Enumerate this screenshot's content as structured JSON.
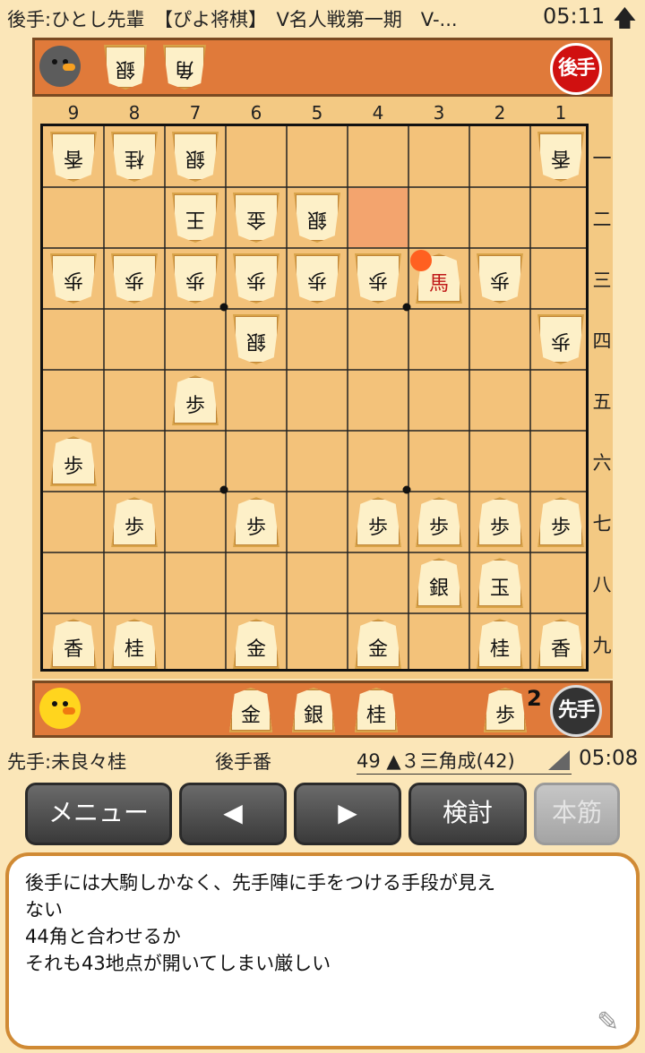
{
  "status_bar": {
    "title": "後手:ひとし先輩　【ぴよ将棋】　V名人戦第一期　V-...",
    "time": "05:11",
    "arrow": "🡅"
  },
  "gote": {
    "badge": "後手",
    "hand": [
      "銀",
      "角"
    ],
    "avatar_color": "#5c5c5c"
  },
  "sente": {
    "badge": "先手",
    "hand": [
      "金",
      "銀",
      "桂",
      "歩"
    ],
    "pawn_count": "2",
    "avatar_color": "#ffd51e"
  },
  "board": {
    "col_labels": [
      "9",
      "8",
      "7",
      "6",
      "5",
      "4",
      "3",
      "2",
      "1"
    ],
    "row_labels": [
      "一",
      "二",
      "三",
      "四",
      "五",
      "六",
      "七",
      "八",
      "九"
    ],
    "highlight_square": "4二",
    "pieces_gote": [
      {
        "sq": "9一",
        "p": "香"
      },
      {
        "sq": "8一",
        "p": "桂"
      },
      {
        "sq": "7一",
        "p": "銀"
      },
      {
        "sq": "1一",
        "p": "香"
      },
      {
        "sq": "7二",
        "p": "王"
      },
      {
        "sq": "6二",
        "p": "金"
      },
      {
        "sq": "5二",
        "p": "銀"
      },
      {
        "sq": "9三",
        "p": "歩"
      },
      {
        "sq": "8三",
        "p": "歩"
      },
      {
        "sq": "7三",
        "p": "歩"
      },
      {
        "sq": "6三",
        "p": "歩"
      },
      {
        "sq": "5三",
        "p": "歩"
      },
      {
        "sq": "4三",
        "p": "歩"
      },
      {
        "sq": "2三",
        "p": "歩"
      },
      {
        "sq": "6四",
        "p": "銀"
      },
      {
        "sq": "1四",
        "p": "歩"
      }
    ],
    "pieces_sente": [
      {
        "sq": "3三",
        "p": "馬",
        "promoted": true
      },
      {
        "sq": "7五",
        "p": "歩"
      },
      {
        "sq": "9六",
        "p": "歩"
      },
      {
        "sq": "8七",
        "p": "歩"
      },
      {
        "sq": "6七",
        "p": "歩"
      },
      {
        "sq": "4七",
        "p": "歩"
      },
      {
        "sq": "3七",
        "p": "歩"
      },
      {
        "sq": "2七",
        "p": "歩"
      },
      {
        "sq": "1七",
        "p": "歩"
      },
      {
        "sq": "3八",
        "p": "銀"
      },
      {
        "sq": "2八",
        "p": "玉"
      },
      {
        "sq": "9九",
        "p": "香"
      },
      {
        "sq": "8九",
        "p": "桂"
      },
      {
        "sq": "6九",
        "p": "金"
      },
      {
        "sq": "4九",
        "p": "金"
      },
      {
        "sq": "2九",
        "p": "桂"
      },
      {
        "sq": "1九",
        "p": "香"
      }
    ]
  },
  "info": {
    "sente_player": "先手:未良々桂",
    "turn": "後手番",
    "move": "49 ▲３三角成(42)",
    "time": "05:08"
  },
  "buttons": {
    "menu": "メニュー",
    "prev": "◀",
    "next": "▶",
    "analyze": "検討",
    "mainline": "本筋"
  },
  "comment": {
    "lines": [
      "後手には大駒しかなく、先手陣に手をつける手段が見え",
      "ない",
      "44角と合わせるか",
      "それも43地点が開いてしまい厳しい"
    ],
    "icon": "pencil-icon"
  },
  "colors": {
    "board": "#f3c27a",
    "hand_bar": "#e07a3a",
    "highlight": "#f3a46e",
    "gote_badge": "#d01010",
    "promoted_text": "#c01818"
  }
}
